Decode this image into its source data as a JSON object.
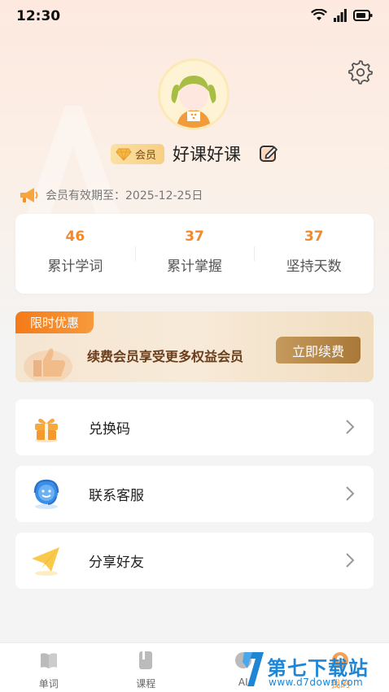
{
  "status_bar": {
    "time": "12:30"
  },
  "profile": {
    "vip_badge": "会员",
    "nickname": "好课好课",
    "expiry_text": "会员有效期至：2025-12-25日"
  },
  "stats": [
    {
      "value": "46",
      "label": "累计学词"
    },
    {
      "value": "37",
      "label": "累计掌握"
    },
    {
      "value": "37",
      "label": "坚持天数"
    }
  ],
  "promo": {
    "tag": "限时优惠",
    "text": "续费会员享受更多权益会员",
    "button": "立即续费"
  },
  "menu": [
    {
      "label": "兑换码",
      "icon": "gift-icon"
    },
    {
      "label": "联系客服",
      "icon": "customer-service-icon"
    },
    {
      "label": "分享好友",
      "icon": "paper-plane-icon"
    }
  ],
  "tabs": [
    {
      "label": "单词",
      "icon": "book-icon"
    },
    {
      "label": "课程",
      "icon": "course-icon"
    },
    {
      "label": "AI",
      "icon": "ai-icon"
    },
    {
      "label": "我的",
      "icon": "profile-icon"
    }
  ],
  "watermark": {
    "title": "第七下载站",
    "url": "www.d7down.com"
  },
  "colors": {
    "accent": "#f08a2c",
    "promo_tag": "#f57a17",
    "watermark": "#1f86d6"
  }
}
